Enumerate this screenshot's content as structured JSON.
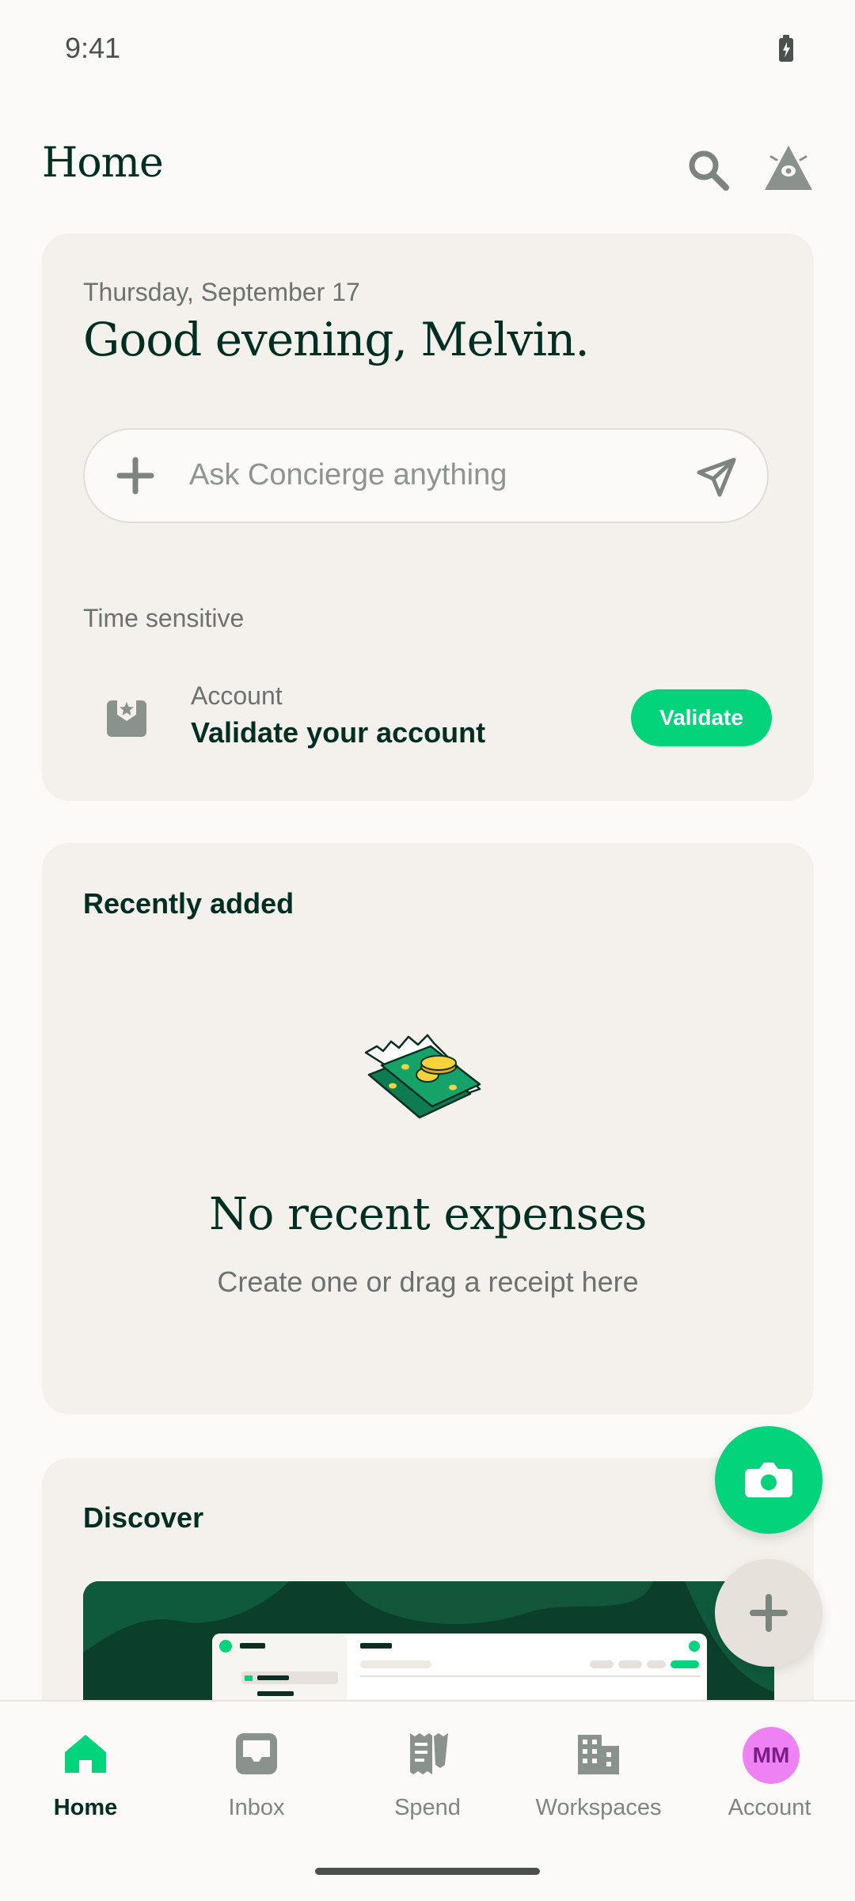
{
  "status_bar": {
    "time": "9:41"
  },
  "header": {
    "title": "Home"
  },
  "greeting_card": {
    "date": "Thursday, September 17",
    "greeting": "Good evening, Melvin.",
    "concierge_placeholder": "Ask Concierge anything",
    "section_label": "Time sensitive",
    "task": {
      "category": "Account",
      "title": "Validate your account",
      "button_label": "Validate"
    }
  },
  "recent_card": {
    "title": "Recently added",
    "empty_title": "No recent expenses",
    "empty_subtitle": "Create one or drag a receipt here"
  },
  "discover_card": {
    "title": "Discover"
  },
  "bottom_nav": {
    "items": [
      {
        "label": "Home",
        "icon": "home-icon",
        "active": true
      },
      {
        "label": "Inbox",
        "icon": "inbox-icon",
        "active": false
      },
      {
        "label": "Spend",
        "icon": "receipt-icon",
        "active": false
      },
      {
        "label": "Workspaces",
        "icon": "buildings-icon",
        "active": false
      },
      {
        "label": "Account",
        "icon": "avatar",
        "active": false
      }
    ],
    "avatar_initials": "MM"
  },
  "colors": {
    "accent": "#03D47C",
    "text_dark": "#002E22",
    "card_bg": "#F4F1EC",
    "avatar": "#EE82F4"
  }
}
